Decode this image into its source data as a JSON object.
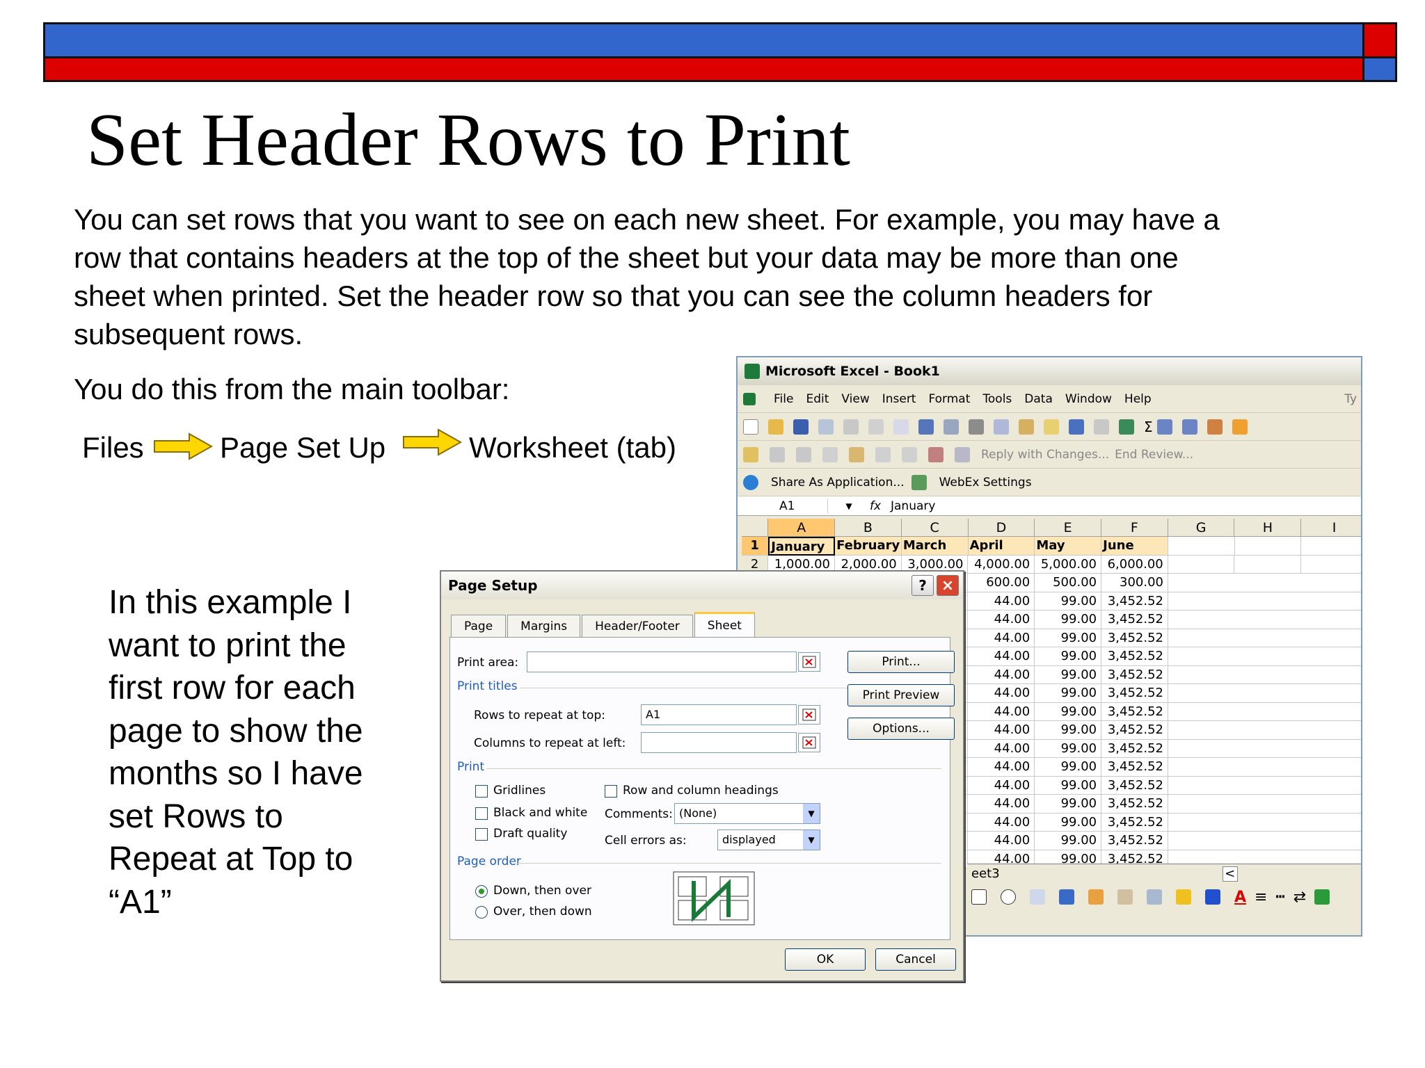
{
  "slide": {
    "title": "Set Header Rows to Print",
    "para1_lines": [
      "You can set rows that you want to see on each new sheet.  For example, you may have a",
      "row that contains headers at the top of the sheet but your data may be more than one",
      "sheet when printed. Set the header row so that you can see the column headers for",
      "subsequent rows."
    ],
    "para2": "You do this from the main toolbar:",
    "path": [
      "Files",
      "Page Set Up",
      "Worksheet (tab)"
    ],
    "side_lines": [
      "In this example I",
      "want to print the",
      "first row for each",
      "page to show the",
      "months so I have",
      "set Rows to",
      "Repeat at Top to",
      "“A1”"
    ],
    "colors": {
      "bar_blue": "#3366cc",
      "bar_red": "#dd0000",
      "arrow": "#ffd700"
    }
  },
  "excel": {
    "title": "Microsoft Excel - Book1",
    "menu": [
      "File",
      "Edit",
      "View",
      "Insert",
      "Format",
      "Tools",
      "Data",
      "Window",
      "Help"
    ],
    "menu_right": "Ty",
    "reviewing_toolbar": [
      "Reply with Changes...",
      "End Review..."
    ],
    "webex_toolbar": [
      "Share As Application...",
      "WebEx Settings"
    ],
    "name_box": "A1",
    "formula_icon": "fx",
    "formula_value": "January",
    "columns": [
      "A",
      "B",
      "C",
      "D",
      "E",
      "F",
      "G",
      "H",
      "I"
    ],
    "header_row": [
      "January",
      "February",
      "March",
      "April",
      "May",
      "June"
    ],
    "row2": [
      "1,000.00",
      "2,000.00",
      "3,000.00",
      "4,000.00",
      "5,000.00",
      "6,000.00"
    ],
    "row3": [
      "600.00",
      "500.00",
      "300.00"
    ],
    "repeat_row": [
      "44.00",
      "99.00",
      "3,452.52"
    ],
    "sheet_tab": "eet3"
  },
  "dialog": {
    "title": "Page Setup",
    "help_btn": "?",
    "close_btn": "×",
    "tabs": [
      "Page",
      "Margins",
      "Header/Footer",
      "Sheet"
    ],
    "active_tab": "Sheet",
    "print_area_label": "Print area:",
    "print_area_value": "",
    "print_titles_group": "Print titles",
    "rows_repeat_label": "Rows to repeat at top:",
    "rows_repeat_value": "A1",
    "cols_repeat_label": "Columns to repeat at left:",
    "cols_repeat_value": "",
    "print_group": "Print",
    "gridlines": "Gridlines",
    "black_white": "Black and white",
    "draft_quality": "Draft quality",
    "row_col_headings": "Row and column headings",
    "comments_label": "Comments:",
    "comments_value": "(None)",
    "cell_errors_label": "Cell errors as:",
    "cell_errors_value": "displayed",
    "page_order_group": "Page order",
    "down_then_over": "Down, then over",
    "over_then_down": "Over, then down",
    "buttons": {
      "print": "Print...",
      "preview": "Print Preview",
      "options": "Options...",
      "ok": "OK",
      "cancel": "Cancel"
    }
  }
}
